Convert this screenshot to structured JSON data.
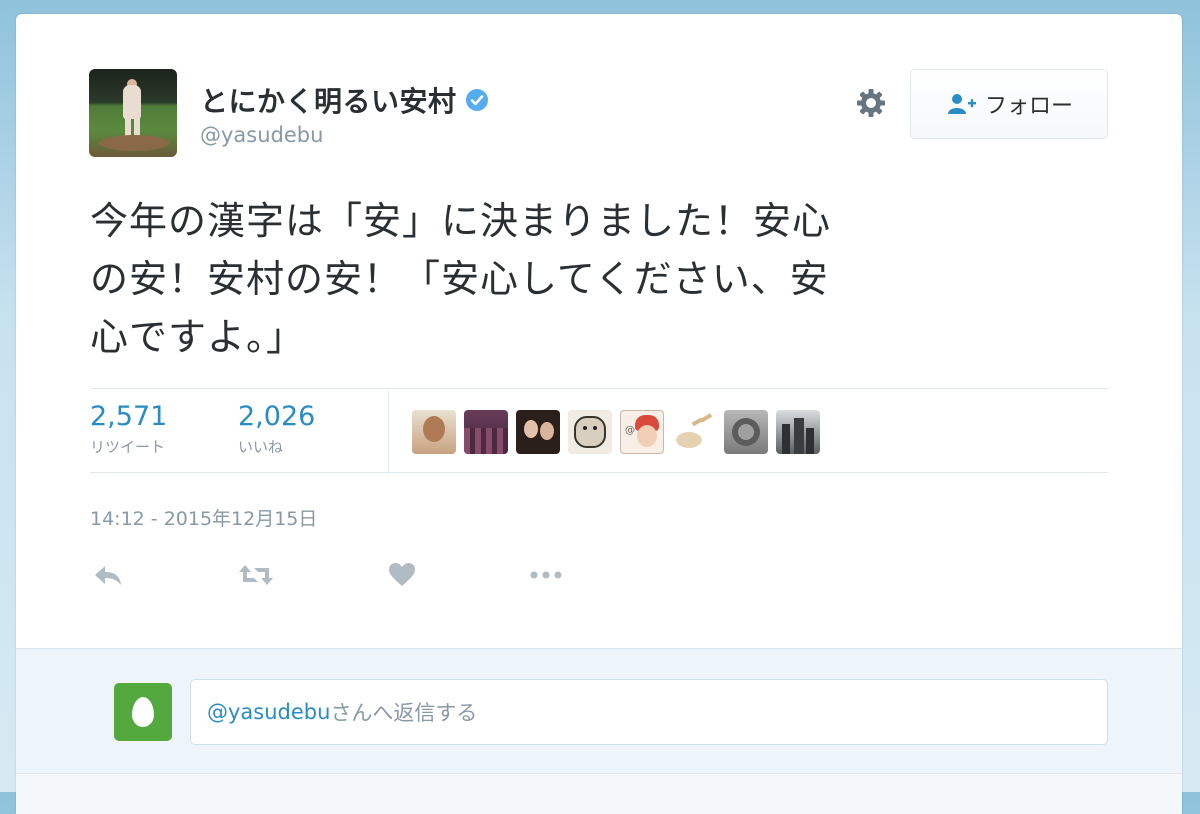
{
  "author": {
    "display_name": "とにかく明るい安村",
    "handle": "@yasudebu",
    "verified": true,
    "avatar_icon": "avatar-photo"
  },
  "follow_button": {
    "label": "フォロー",
    "icon": "add-user-icon"
  },
  "settings_icon": "gear-icon",
  "tweet": {
    "text_line1": "今年の漢字は「安」に決まりました！安心",
    "text_line2": "の安！安村の安！「安心してください、安",
    "text_line3": "心ですよ。」"
  },
  "stats": {
    "retweets": {
      "count": "2,571",
      "label": "リツイート"
    },
    "likes": {
      "count": "2,026",
      "label": "いいね"
    }
  },
  "liker_avatars": [
    "liker-1",
    "liker-2",
    "liker-3",
    "liker-4",
    "liker-5",
    "liker-6",
    "liker-7",
    "liker-8"
  ],
  "timestamp": "14:12 - 2015年12月15日",
  "actions": [
    "reply-icon",
    "retweet-icon",
    "like-icon",
    "more-icon"
  ],
  "reply_box": {
    "mention": "@yasudebu",
    "placeholder_suffix": "さんへ返信する"
  },
  "colors": {
    "link_blue": "#2a8cc4",
    "text": "#292f33",
    "muted": "#8899a6",
    "verified_blue": "#55acee",
    "egg_green": "#54a93e"
  }
}
